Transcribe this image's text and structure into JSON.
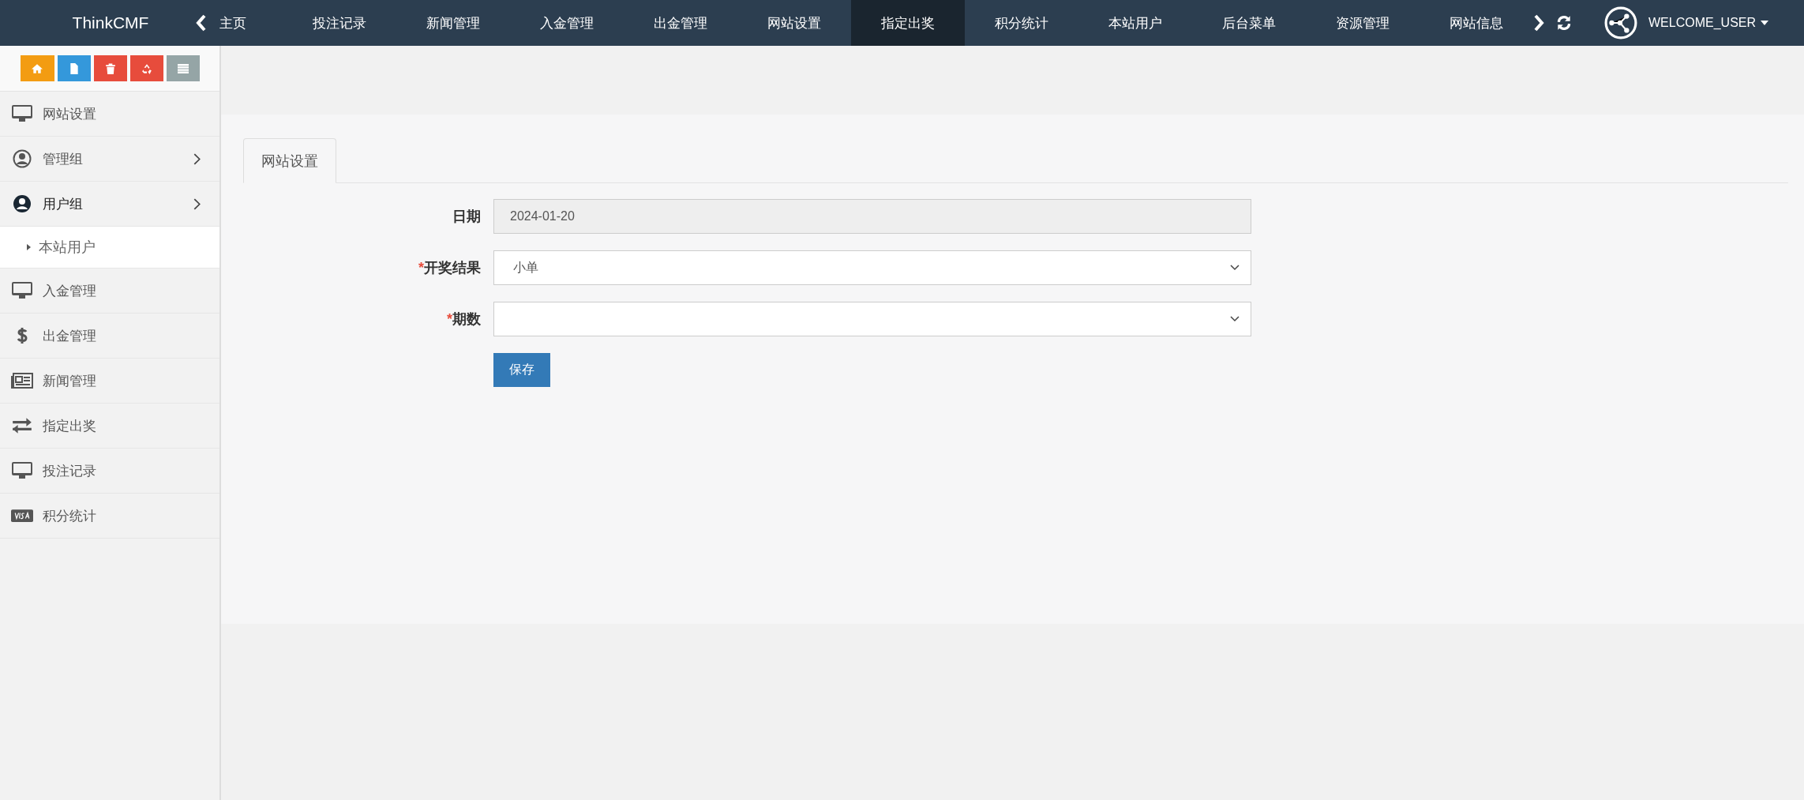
{
  "brand": "ThinkCMF",
  "nav": [
    {
      "label": "主页",
      "selected": false
    },
    {
      "label": "投注记录",
      "selected": false
    },
    {
      "label": "新闻管理",
      "selected": false
    },
    {
      "label": "入金管理",
      "selected": false
    },
    {
      "label": "出金管理",
      "selected": false
    },
    {
      "label": "网站设置",
      "selected": false
    },
    {
      "label": "指定出奖",
      "selected": true
    },
    {
      "label": "积分统计",
      "selected": false
    },
    {
      "label": "本站用户",
      "selected": false
    },
    {
      "label": "后台菜单",
      "selected": false
    },
    {
      "label": "资源管理",
      "selected": false
    },
    {
      "label": "网站信息",
      "selected": false
    }
  ],
  "user": {
    "name": "WELCOME_USER"
  },
  "toolbar": [
    {
      "color": "#f39c12"
    },
    {
      "color": "#3498db"
    },
    {
      "color": "#e74c3c"
    },
    {
      "color": "#e74c3c"
    },
    {
      "color": "#95a5a6"
    }
  ],
  "sidebar": {
    "items": [
      {
        "label": "网站设置",
        "submenu": false,
        "expanded": false
      },
      {
        "label": "管理组",
        "submenu": true,
        "expanded": false
      },
      {
        "label": "用户组",
        "submenu": true,
        "expanded": true,
        "children": [
          {
            "label": "本站用户",
            "selected": true
          }
        ]
      },
      {
        "label": "入金管理",
        "submenu": false,
        "expanded": false
      },
      {
        "label": "出金管理",
        "submenu": false,
        "expanded": false
      },
      {
        "label": "新闻管理",
        "submenu": false,
        "expanded": false
      },
      {
        "label": "指定出奖",
        "submenu": false,
        "expanded": false
      },
      {
        "label": "投注记录",
        "submenu": false,
        "expanded": false
      },
      {
        "label": "积分统计",
        "submenu": false,
        "expanded": false
      }
    ]
  },
  "tabs": [
    {
      "label": "网站设置",
      "selected": true
    }
  ],
  "form": {
    "fields": [
      {
        "kind": "text",
        "label": "日期",
        "value": "2024-01-20",
        "disabled": true
      },
      {
        "kind": "select",
        "label": "开奖结果",
        "required_mark": "*",
        "value": "小单",
        "disabled": false
      },
      {
        "kind": "select",
        "label": "期数",
        "required_mark": "*",
        "disabled": false
      }
    ],
    "submit": "保存"
  }
}
